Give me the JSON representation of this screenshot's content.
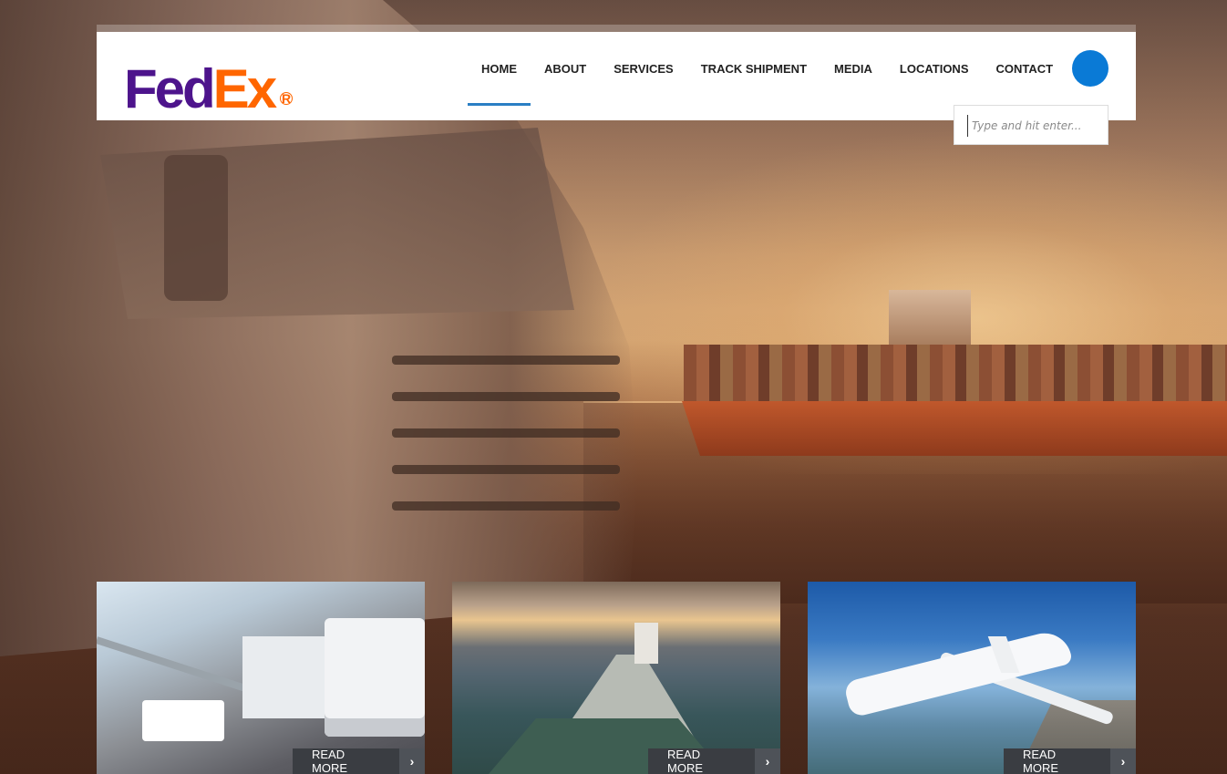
{
  "brand": {
    "logo_part1": "Fed",
    "logo_part2": "Ex",
    "registered_mark": "R",
    "colors": {
      "purple": "#4d148c",
      "orange": "#ff6600",
      "accent_blue": "#0a7ad6"
    }
  },
  "nav": {
    "items": [
      {
        "label": "HOME",
        "active": true
      },
      {
        "label": "ABOUT",
        "active": false
      },
      {
        "label": "SERVICES",
        "active": false
      },
      {
        "label": "TRACK SHIPMENT",
        "active": false
      },
      {
        "label": "MEDIA",
        "active": false
      },
      {
        "label": "LOCATIONS",
        "active": false
      },
      {
        "label": "CONTACT",
        "active": false
      }
    ],
    "search_icon": "search-icon"
  },
  "search": {
    "placeholder": "Type and hit enter..."
  },
  "cards": [
    {
      "image": "truck-image",
      "read_more": "READ MORE",
      "arrow_icon": "chevron-right-icon"
    },
    {
      "image": "ship-image",
      "read_more": "READ MORE",
      "arrow_icon": "chevron-right-icon"
    },
    {
      "image": "airplane-image",
      "read_more": "READ MORE",
      "arrow_icon": "chevron-right-icon"
    }
  ]
}
